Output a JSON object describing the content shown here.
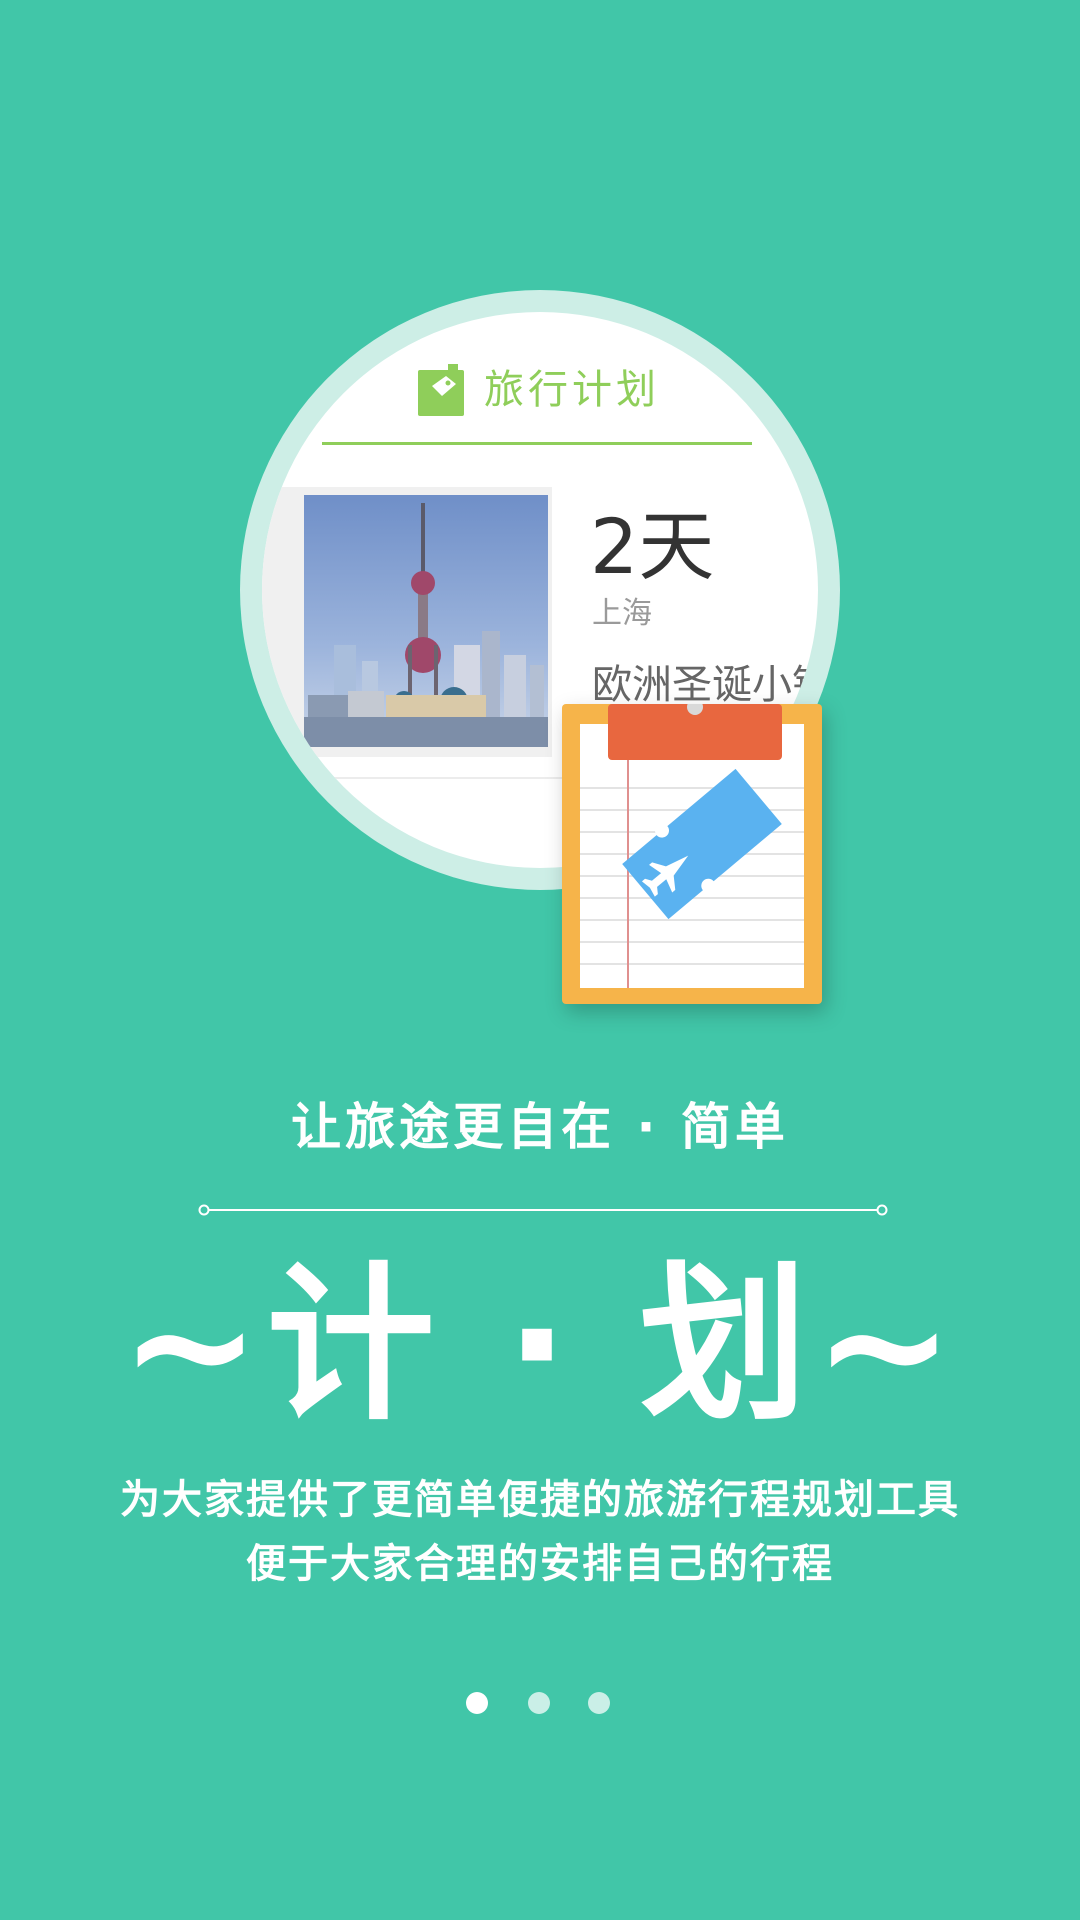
{
  "colors": {
    "background": "#41c6a8",
    "accent_green": "#8fce5a",
    "clipboard_orange": "#f6b44a",
    "clip_red": "#e8673f",
    "ticket_blue": "#5ab2f0"
  },
  "preview": {
    "header_icon": "tag-icon",
    "title": "旅行计划",
    "item": {
      "photo": "shanghai-skyline-photo",
      "days": "2天",
      "city": "上海",
      "trip_name": "欧洲圣诞小镇"
    }
  },
  "illustration": {
    "clipboard_icon": "clipboard-icon",
    "ticket_icon": "plane-ticket-icon"
  },
  "tagline": "让旅途更自在 · 简单",
  "headline": "~计 · 划~",
  "description": {
    "line1": "为大家提供了更简单便捷的旅游行程规划工具",
    "line2": "便于大家合理的安排自己的行程"
  },
  "pager": {
    "total": 3,
    "active": 1
  }
}
